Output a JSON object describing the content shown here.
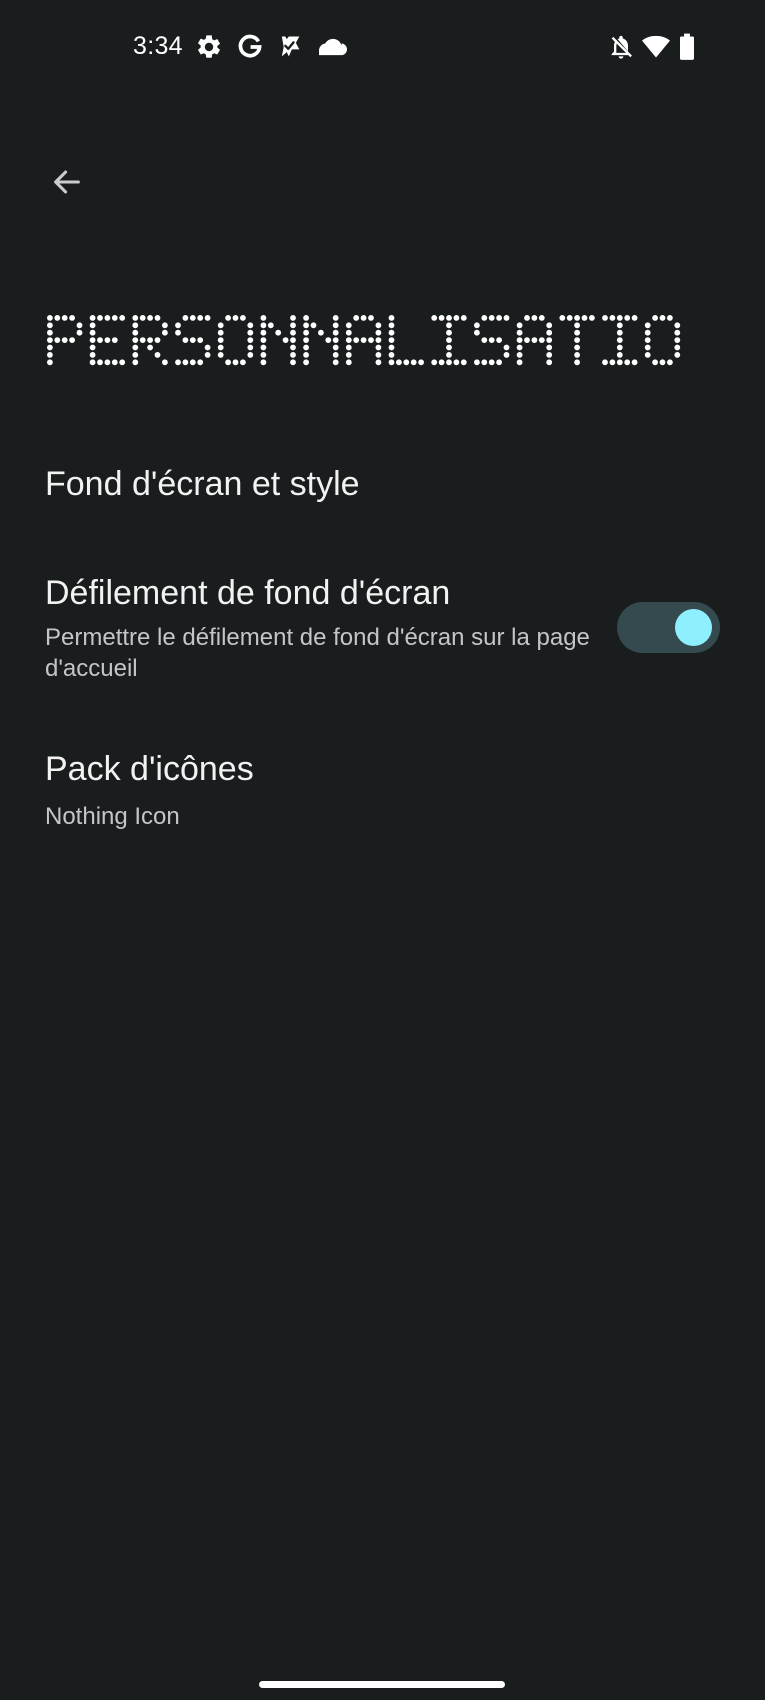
{
  "status_bar": {
    "time": "3:34",
    "left_icons": [
      "gear-icon",
      "google-icon",
      "ticket-check-icon",
      "cloud-icon"
    ],
    "right_icons": [
      "notifications-off-icon",
      "wifi-icon",
      "battery-icon"
    ]
  },
  "header": {
    "back_icon": "arrow-left-icon",
    "title": "PERSONNALISATION"
  },
  "settings": {
    "items": [
      {
        "title": "Fond d'écran et style"
      },
      {
        "title": "Défilement de fond d'écran",
        "subtitle": "Permettre le défilement de fond d'écran sur la page d'accueil",
        "toggle_on": true
      },
      {
        "title": "Pack d'icônes",
        "subtitle": "Nothing Icon"
      }
    ]
  },
  "colors": {
    "background": "#1a1d1e",
    "toggle_track": "#344a4f",
    "toggle_knob": "#8ef0ff"
  }
}
